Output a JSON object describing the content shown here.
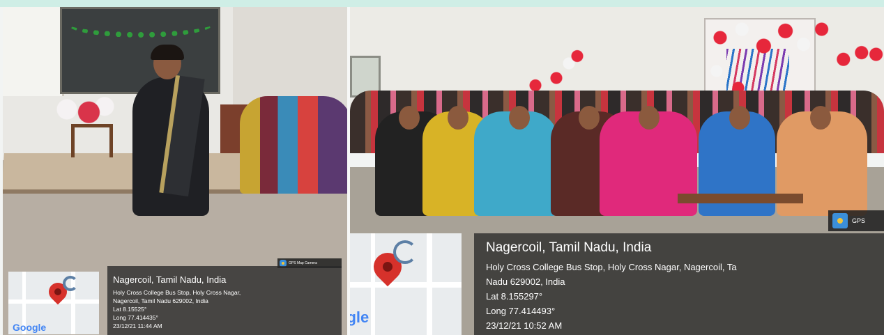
{
  "photos": [
    {
      "location_title": "Nagercoil, Tamil Nadu, India",
      "address_lines": [
        "Holy Cross College Bus Stop, Holy Cross Nagar,",
        "Nagercoil, Tamil Nadu 629002, India"
      ],
      "lat": "Lat 8.15525°",
      "long": "Long 77.414435°",
      "timestamp": "23/12/21 11:44 AM",
      "badge": "GPS Map Camera",
      "map_brand": "Google"
    },
    {
      "location_title": "Nagercoil, Tamil Nadu, India",
      "address_lines": [
        "Holy Cross College Bus Stop, Holy Cross Nagar, Nagercoil, Ta",
        "Nadu 629002, India"
      ],
      "lat": "Lat 8.155297°",
      "long": "Long 77.414493°",
      "timestamp": "23/12/21 10:52 AM",
      "badge": "GPS",
      "map_brand": "ogle"
    }
  ],
  "colors": {
    "pin": "#d6312b",
    "overlay": "#282828",
    "top_band": "#cfeee6"
  },
  "icons": [
    "map-pin-icon",
    "gps-camera-icon"
  ]
}
